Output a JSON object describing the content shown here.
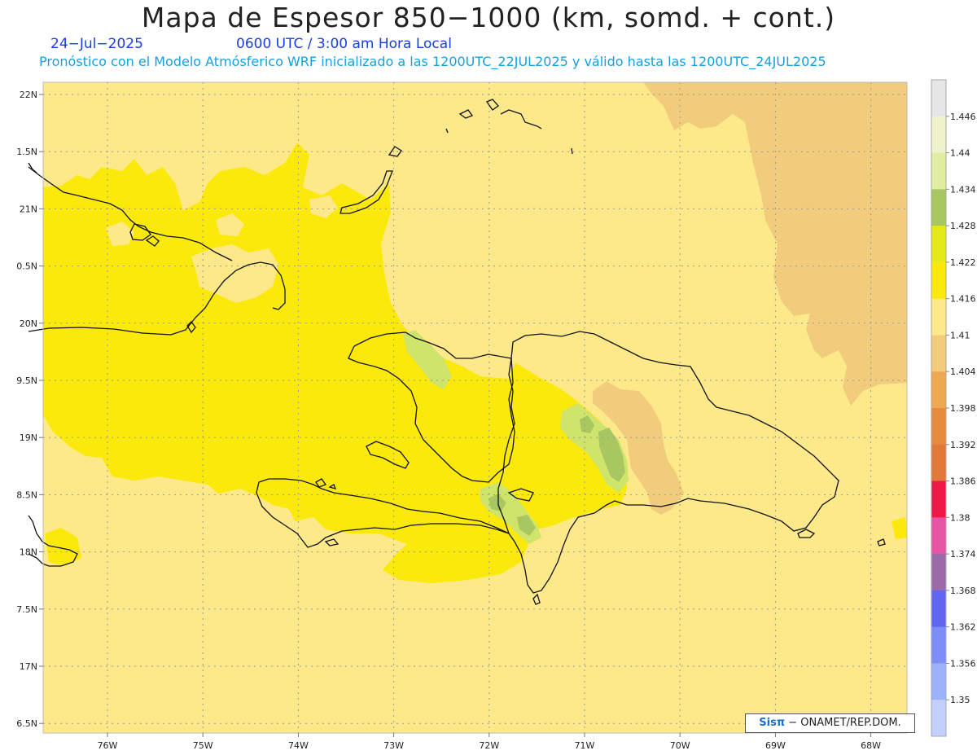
{
  "header": {
    "title": "Mapa de Espesor 850−1000 (km, somd. + cont.)",
    "date": "24−Jul−2025",
    "time": "0600 UTC / 3:00 am Hora Local",
    "model": "Pronóstico con el Modelo Atmósferico WRF inicializado a las 1200UTC_22JUL2025 y válido hasta las  1200UTC_24JUL2025"
  },
  "map": {
    "lat_labels": [
      "22N",
      "1.5N",
      "21N",
      "0.5N",
      "20N",
      "9.5N",
      "19N",
      "8.5N",
      "18N",
      "7.5N",
      "17N",
      "6.5N"
    ],
    "lon_labels": [
      "76W",
      "75W",
      "74W",
      "73W",
      "72W",
      "71W",
      "70W",
      "69W",
      "68W"
    ],
    "colors": {
      "background": "#fde98a",
      "yellow": "#fbe90c",
      "tan": "#f1cc7c",
      "green_light": "#cfe46a",
      "green": "#a9c761"
    }
  },
  "colorbar": {
    "labels": [
      "1.446",
      "1.44",
      "1.434",
      "1.428",
      "1.422",
      "1.416",
      "1.41",
      "1.404",
      "1.398",
      "1.392",
      "1.386",
      "1.38",
      "1.374",
      "1.368",
      "1.362",
      "1.356",
      "1.35"
    ],
    "colors": [
      "#e6e6e6",
      "#eef3cc",
      "#dfeea0",
      "#a9c761",
      "#e3ea18",
      "#fbe90c",
      "#fde98a",
      "#f1cc7c",
      "#eda850",
      "#e68a3c",
      "#e2783a",
      "#ee1846",
      "#e654a4",
      "#9b6aa8",
      "#6066ee",
      "#7d8ef8",
      "#9cb2fb",
      "#c3cffc"
    ]
  },
  "credit": {
    "logo": "Sisπ",
    "text": "− ONAMET/REP.DOM."
  }
}
